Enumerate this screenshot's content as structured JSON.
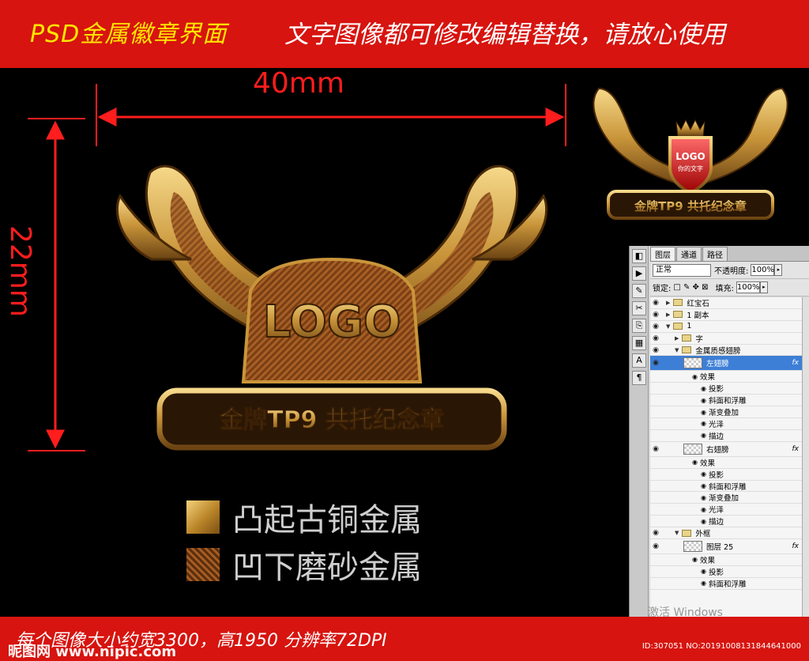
{
  "top_banner": {
    "left_text": "PSD金属徽章界面",
    "right_text": "文字图像都可修改编辑替换，请放心使用"
  },
  "dimensions": {
    "width_label": "40mm",
    "height_label": "22mm"
  },
  "badge": {
    "logo": "LOGO",
    "banner_text": "金牌TP9 共托纪念章",
    "shield_logo": "LOGO",
    "shield_subtext": "你的文字"
  },
  "legend": [
    {
      "label": "凸起古铜金属"
    },
    {
      "label": "凹下磨砂金属"
    }
  ],
  "ps_panel": {
    "tabs": [
      "图层",
      "通道",
      "路径"
    ],
    "blend_mode": "正常",
    "opacity_label": "不透明度:",
    "opacity_value": "100%",
    "lock_label": "锁定:",
    "fill_label": "填充:",
    "fill_value": "100%",
    "layers": [
      {
        "name": "红宝石",
        "kind": "folder",
        "indent": 0,
        "collapsed": true
      },
      {
        "name": "1 副本",
        "kind": "folder",
        "indent": 0,
        "collapsed": true
      },
      {
        "name": "1",
        "kind": "folder",
        "indent": 0,
        "collapsed": false
      },
      {
        "name": "字",
        "kind": "folder",
        "indent": 1,
        "collapsed": true
      },
      {
        "name": "金属质感翅膀",
        "kind": "folder",
        "indent": 1,
        "collapsed": false
      },
      {
        "name": "左翅膀",
        "kind": "layer",
        "indent": 2,
        "selected": true,
        "fx": "fx"
      },
      {
        "name": "效果",
        "kind": "effect",
        "indent": 3
      },
      {
        "name": "投影",
        "kind": "effect",
        "indent": 4
      },
      {
        "name": "斜面和浮雕",
        "kind": "effect",
        "indent": 4
      },
      {
        "name": "渐变叠加",
        "kind": "effect",
        "indent": 4
      },
      {
        "name": "光泽",
        "kind": "effect",
        "indent": 4
      },
      {
        "name": "描边",
        "kind": "effect",
        "indent": 4
      },
      {
        "name": "右翅膀",
        "kind": "layer",
        "indent": 2,
        "fx": "fx"
      },
      {
        "name": "效果",
        "kind": "effect",
        "indent": 3
      },
      {
        "name": "投影",
        "kind": "effect",
        "indent": 4
      },
      {
        "name": "斜面和浮雕",
        "kind": "effect",
        "indent": 4
      },
      {
        "name": "渐变叠加",
        "kind": "effect",
        "indent": 4
      },
      {
        "name": "光泽",
        "kind": "effect",
        "indent": 4
      },
      {
        "name": "描边",
        "kind": "effect",
        "indent": 4
      },
      {
        "name": "外框",
        "kind": "folder",
        "indent": 1,
        "collapsed": false
      },
      {
        "name": "图层 25",
        "kind": "layer",
        "indent": 2,
        "fx": "fx"
      },
      {
        "name": "效果",
        "kind": "effect",
        "indent": 3
      },
      {
        "name": "投影",
        "kind": "effect",
        "indent": 4
      },
      {
        "name": "斜面和浮雕",
        "kind": "effect",
        "indent": 4
      }
    ]
  },
  "watermark": "激活 Windows",
  "bottom_banner": {
    "info": "每个图像大小约宽3300，高1950    分辨率72DPI",
    "site": "昵图网 www.nipic.com",
    "id_text": "ID:307051 NO:20191008131844641000"
  },
  "colors": {
    "banner_red": "#d7140f",
    "banner_yellow": "#ffe600",
    "dimension_red": "#ff1d1d",
    "gold": "#c9953a",
    "selected_layer": "#3d7fd6"
  }
}
